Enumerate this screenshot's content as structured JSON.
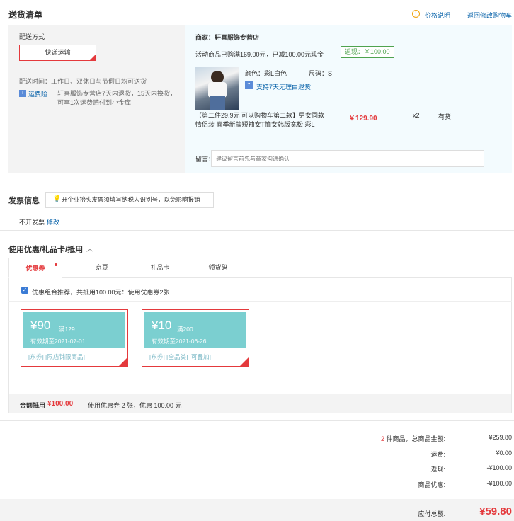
{
  "header": {
    "title": "送货清单",
    "price_note": "价格说明",
    "back_link": "返回修改购物车"
  },
  "shipping": {
    "method_label": "配送方式",
    "method_value": "快递运输",
    "time_text": "配送时间：工作日、双休日与节假日均可送货",
    "insurance_link": "运费险",
    "insurance_desc": "轩喜服饰专营店7天内退货，15天内换货，可享1次运费赔付到小金库"
  },
  "store": {
    "name": "商家：轩喜服饰专营店",
    "promo": "活动商品已购满169.00元，已减100.00元现金",
    "rebate_badge": "返现：￥100.00"
  },
  "product": {
    "color": "颜色：彩L白色",
    "size": "尺码：S",
    "return_policy": "支持7天无理由退货",
    "title": "【第二件29.9元 可以购物车第二款】男女同款 情侣装 春季新款短袖女T恤女韩版宽松 彩L",
    "price": "￥129.90",
    "qty": "x2",
    "stock": "有货"
  },
  "message": {
    "label": "留言：",
    "placeholder": "建议留言前先与商家沟通确认"
  },
  "invoice": {
    "title": "发票信息",
    "tip": "开企业抬头发票须填写纳税人识别号，以免影响报销",
    "value": "不开发票",
    "edit": "修改"
  },
  "coupons": {
    "title": "使用优惠/礼品卡/抵用",
    "tabs": [
      "优惠券",
      "京豆",
      "礼品卡",
      "领货码"
    ],
    "recommend": "优惠组合推荐，共抵用100.00元：使用优惠券2张",
    "items": [
      {
        "amount": "¥90",
        "condition": "满129",
        "expiry": "有效期至2021-07-01",
        "tags": "[东券] [限店铺限商品]"
      },
      {
        "amount": "¥10",
        "condition": "满200",
        "expiry": "有效期至2021-06-26",
        "tags": "[东券] [全品类] [可叠加]"
      }
    ],
    "footer_label": "金额抵用",
    "footer_amount": "¥100.00",
    "footer_desc": "使用优惠券 2 张，优惠 100.00 元"
  },
  "summary": {
    "count": "2",
    "count_suffix": " 件商品，总商品金额:",
    "total": "¥259.80",
    "shipping_label": "运费:",
    "shipping": "¥0.00",
    "rebate_label": "返现:",
    "rebate": "-¥100.00",
    "discount_label": "商品优惠:",
    "discount": "-¥100.00",
    "payable_label": "应付总额:",
    "payable": "¥59.80"
  },
  "colors": {
    "accent_red": "#e4393c",
    "link_blue": "#005ea7",
    "coupon_teal": "#7bcfd0",
    "rebate_green": "#4fa34f"
  }
}
